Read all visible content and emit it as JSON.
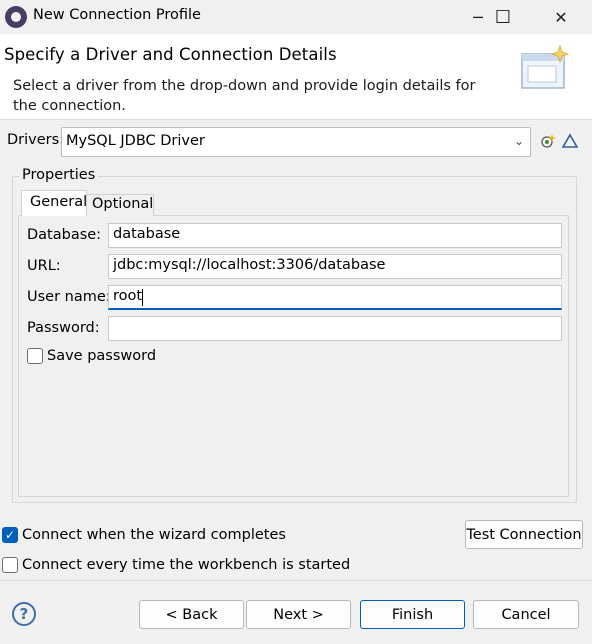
{
  "window": {
    "title": "New Connection Profile",
    "minimize_glyph": "─",
    "maximize_glyph": "☐",
    "close_glyph": "✕"
  },
  "header": {
    "title": "Specify a Driver and Connection Details",
    "description": "Select a driver from the drop-down and provide login details for the connection."
  },
  "drivers": {
    "label": "Drivers:",
    "selected": "MySQL JDBC Driver",
    "new_driver_icon": "new-driver-icon",
    "edit_driver_icon": "edit-driver-icon"
  },
  "properties": {
    "group_label": "Properties",
    "tabs": [
      {
        "label": "General",
        "active": true
      },
      {
        "label": "Optional",
        "active": false
      }
    ],
    "fields": {
      "database": {
        "label": "Database:",
        "value": "database"
      },
      "url": {
        "label": "URL:",
        "value": "jdbc:mysql://localhost:3306/database"
      },
      "username": {
        "label": "User name:",
        "value": "root"
      },
      "password": {
        "label": "Password:",
        "value": ""
      }
    },
    "save_password": {
      "label": "Save password",
      "checked": false
    }
  },
  "options": {
    "connect_on_finish": {
      "label": "Connect when the wizard completes",
      "checked": true
    },
    "connect_on_startup": {
      "label": "Connect every time the workbench is started",
      "checked": false
    },
    "test_connection_label": "Test Connection"
  },
  "footer": {
    "help_glyph": "?",
    "back_label": "< Back",
    "next_label": "Next >",
    "finish_label": "Finish",
    "cancel_label": "Cancel"
  },
  "colors": {
    "accent": "#005fb8",
    "background": "#f0f0f0",
    "banner": "#ffffff"
  }
}
